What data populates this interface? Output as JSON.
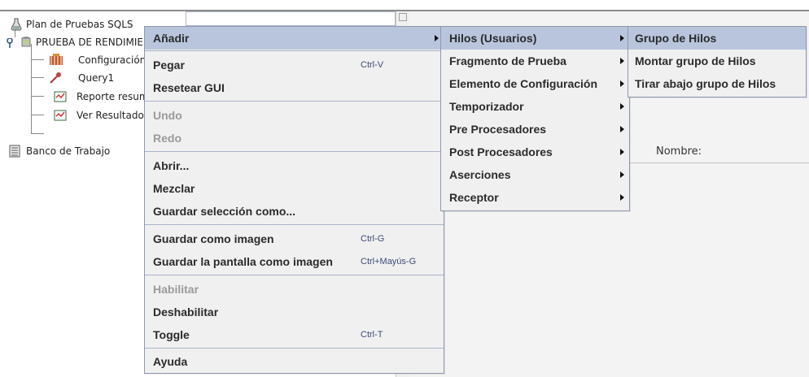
{
  "tree": {
    "items": [
      {
        "label": "Plan de Pruebas SQLS",
        "icon": "flask-icon"
      },
      {
        "label": "PRUEBA DE RENDIMIENTO",
        "icon": "thread-group-icon"
      },
      {
        "label": "Configuración",
        "icon": "config-icon"
      },
      {
        "label": "Query1",
        "icon": "sampler-pipette-icon"
      },
      {
        "label": "Reporte resumen",
        "icon": "report-icon"
      },
      {
        "label": "Ver Resultados",
        "icon": "report-icon"
      },
      {
        "label": "Banco de Trabajo",
        "icon": "workbench-icon"
      }
    ]
  },
  "right_panel": {
    "name_label": "Nombre:"
  },
  "context_menu": {
    "items": [
      {
        "label": "Añadir",
        "shortcut": "",
        "disabled": false,
        "submenu": true,
        "highlighted": true
      },
      {
        "label": "Pegar",
        "shortcut": "Ctrl-V",
        "disabled": false
      },
      {
        "label": "Resetear GUI",
        "shortcut": "",
        "disabled": false
      },
      {
        "label": "Undo",
        "shortcut": "",
        "disabled": true
      },
      {
        "label": "Redo",
        "shortcut": "",
        "disabled": true
      },
      {
        "label": "Abrir...",
        "shortcut": "",
        "disabled": false
      },
      {
        "label": "Mezclar",
        "shortcut": "",
        "disabled": false
      },
      {
        "label": "Guardar selección como...",
        "shortcut": "",
        "disabled": false
      },
      {
        "label": "Guardar como imagen",
        "shortcut": "Ctrl-G",
        "disabled": false
      },
      {
        "label": "Guardar la pantalla como imagen",
        "shortcut": "Ctrl+Mayús-G",
        "disabled": false
      },
      {
        "label": "Habilitar",
        "shortcut": "",
        "disabled": true
      },
      {
        "label": "Deshabilitar",
        "shortcut": "",
        "disabled": false
      },
      {
        "label": "Toggle",
        "shortcut": "Ctrl-T",
        "disabled": false
      },
      {
        "label": "Ayuda",
        "shortcut": "",
        "disabled": false
      }
    ]
  },
  "submenu_add": {
    "items": [
      {
        "label": "Hilos (Usuarios)",
        "highlighted": true
      },
      {
        "label": "Fragmento de Prueba"
      },
      {
        "label": "Elemento de Configuración"
      },
      {
        "label": "Temporizador"
      },
      {
        "label": "Pre Procesadores"
      },
      {
        "label": "Post Procesadores"
      },
      {
        "label": "Aserciones"
      },
      {
        "label": "Receptor"
      }
    ]
  },
  "submenu_threads": {
    "items": [
      {
        "label": "Grupo de Hilos",
        "highlighted": true
      },
      {
        "label": "Montar grupo de Hilos"
      },
      {
        "label": "Tirar abajo grupo de Hilos"
      }
    ]
  },
  "colors": {
    "menu_bg": "#f0f0f0",
    "highlight": "#b8c5dc",
    "menu_border": "#8d99b0",
    "shortcut_text": "#3b4a78",
    "disabled_text": "#9a9a9a"
  }
}
